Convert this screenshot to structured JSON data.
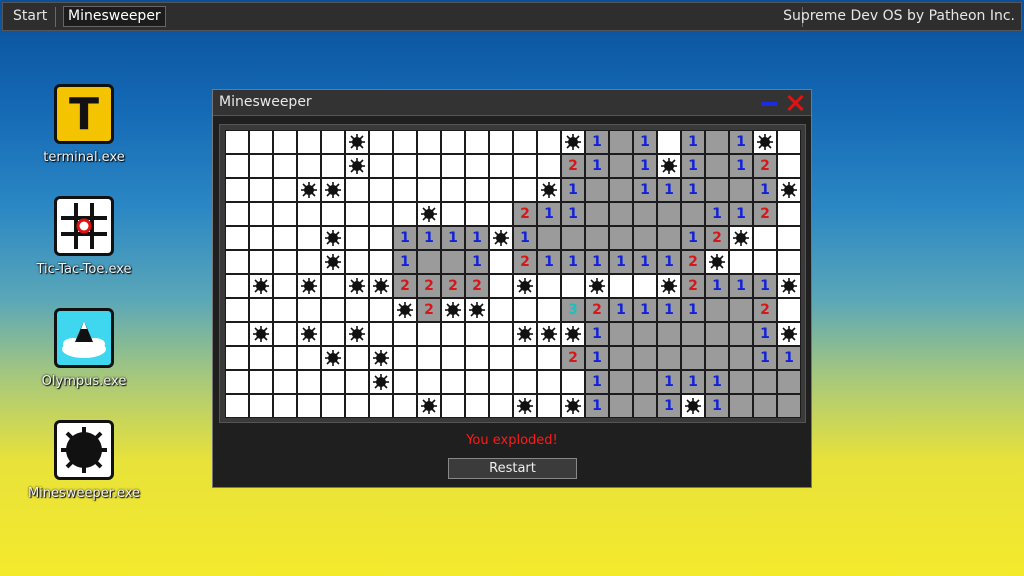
{
  "taskbar": {
    "start_label": "Start",
    "active_window": "Minesweeper",
    "brand": "Supreme Dev OS by Patheon Inc."
  },
  "desktop_icons": [
    {
      "label": "terminal.exe",
      "icon": "terminal-icon"
    },
    {
      "label": "Tic-Tac-Toe.exe",
      "icon": "tic-tac-toe-icon"
    },
    {
      "label": "Olympus.exe",
      "icon": "olympus-icon"
    },
    {
      "label": "Minesweeper.exe",
      "icon": "mine-icon"
    }
  ],
  "window": {
    "title": "Minesweeper",
    "status": "You exploded!",
    "restart_label": "Restart"
  },
  "colors": {
    "num1": "#1222d8",
    "num2": "#d81818",
    "num3": "#1fbfbf",
    "revealed": "#9b9b9b",
    "hidden": "#ffffff",
    "status": "#ff1a1a",
    "close": "#e31212",
    "minimize": "#1a2be0"
  },
  "board": {
    "legend": "H = hidden, M = mine shown, E = revealed empty, 1-3 = revealed number",
    "rows": [
      [
        "H",
        "H",
        "H",
        "H",
        "H",
        "M",
        "H",
        "H",
        "H",
        "H",
        "H",
        "H",
        "H",
        "H",
        "M",
        "1",
        "E",
        "1",
        "H",
        "1",
        "E",
        "1",
        "M",
        "H"
      ],
      [
        "H",
        "H",
        "H",
        "H",
        "H",
        "M",
        "H",
        "H",
        "H",
        "H",
        "H",
        "H",
        "H",
        "H",
        "2",
        "1",
        "E",
        "1",
        "M",
        "1",
        "E",
        "1",
        "2",
        "H"
      ],
      [
        "H",
        "H",
        "H",
        "M",
        "M",
        "H",
        "H",
        "H",
        "H",
        "H",
        "H",
        "H",
        "H",
        "M",
        "1",
        "E",
        "E",
        "1",
        "1",
        "1",
        "E",
        "E",
        "1",
        "M"
      ],
      [
        "H",
        "H",
        "H",
        "H",
        "H",
        "H",
        "H",
        "H",
        "M",
        "H",
        "H",
        "H",
        "2",
        "1",
        "1",
        "E",
        "E",
        "E",
        "E",
        "E",
        "1",
        "1",
        "2",
        "H"
      ],
      [
        "H",
        "H",
        "H",
        "H",
        "M",
        "H",
        "H",
        "1",
        "1",
        "1",
        "1",
        "M",
        "1",
        "E",
        "E",
        "E",
        "E",
        "E",
        "E",
        "1",
        "2",
        "M",
        "H",
        "H"
      ],
      [
        "H",
        "H",
        "H",
        "H",
        "M",
        "H",
        "H",
        "1",
        "E",
        "E",
        "1",
        "H",
        "2",
        "1",
        "1",
        "1",
        "1",
        "1",
        "1",
        "2",
        "M",
        "H",
        "H",
        "H"
      ],
      [
        "H",
        "M",
        "H",
        "M",
        "H",
        "M",
        "M",
        "2",
        "2",
        "2",
        "2",
        "H",
        "M",
        "H",
        "H",
        "M",
        "H",
        "H",
        "M",
        "2",
        "1",
        "1",
        "1",
        "M"
      ],
      [
        "H",
        "H",
        "H",
        "H",
        "H",
        "H",
        "H",
        "M",
        "2",
        "M",
        "M",
        "H",
        "H",
        "H",
        "3",
        "2",
        "1",
        "1",
        "1",
        "1",
        "E",
        "E",
        "2",
        "H"
      ],
      [
        "H",
        "M",
        "H",
        "M",
        "H",
        "M",
        "H",
        "H",
        "H",
        "H",
        "H",
        "H",
        "M",
        "M",
        "M",
        "1",
        "E",
        "E",
        "E",
        "E",
        "E",
        "E",
        "1",
        "M"
      ],
      [
        "H",
        "H",
        "H",
        "H",
        "M",
        "H",
        "M",
        "H",
        "H",
        "H",
        "H",
        "H",
        "H",
        "H",
        "2",
        "1",
        "E",
        "E",
        "E",
        "E",
        "E",
        "E",
        "1",
        "1"
      ],
      [
        "H",
        "H",
        "H",
        "H",
        "H",
        "H",
        "M",
        "H",
        "H",
        "H",
        "H",
        "H",
        "H",
        "H",
        "H",
        "1",
        "E",
        "E",
        "1",
        "1",
        "1",
        "E",
        "E",
        "E"
      ],
      [
        "H",
        "H",
        "H",
        "H",
        "H",
        "H",
        "H",
        "H",
        "M",
        "H",
        "H",
        "H",
        "M",
        "H",
        "M",
        "1",
        "E",
        "E",
        "1",
        "M",
        "1",
        "E",
        "E",
        "E"
      ]
    ]
  }
}
